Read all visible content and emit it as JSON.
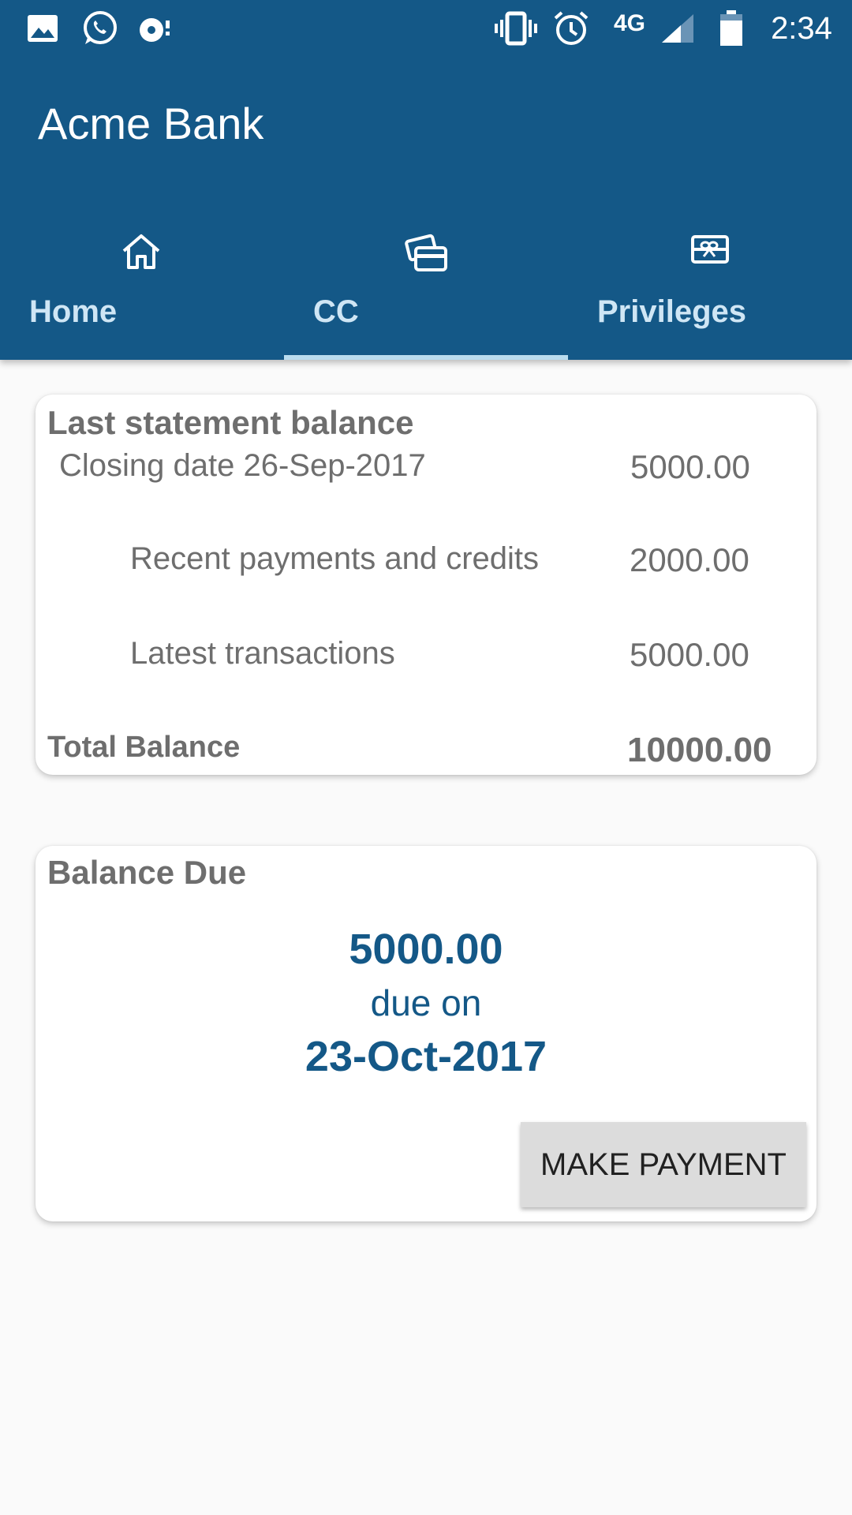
{
  "status_bar": {
    "network": "4G",
    "time": "2:34",
    "left_icons": [
      "image-icon",
      "whatsapp-icon",
      "sync-icon"
    ],
    "right_icons": [
      "vibrate-icon",
      "alarm-icon",
      "signal-icon",
      "battery-icon"
    ]
  },
  "app": {
    "title": "Acme Bank",
    "primary_color": "#145887"
  },
  "tabs": [
    {
      "label": "Home",
      "icon": "home-icon",
      "selected": false
    },
    {
      "label": "CC",
      "icon": "credit-card-icon",
      "selected": true
    },
    {
      "label": "Privileges",
      "icon": "gift-card-icon",
      "selected": false
    }
  ],
  "statement": {
    "title": "Last statement balance",
    "closing_label": "Closing date 26-Sep-2017",
    "closing_value": "5000.00",
    "payments_label": "Recent payments and credits",
    "payments_value": "2000.00",
    "transactions_label": "Latest transactions",
    "transactions_value": "5000.00",
    "total_label": "Total Balance",
    "total_value": "10000.00"
  },
  "balance_due": {
    "title": "Balance Due",
    "amount": "5000.00",
    "due_on_label": "due on",
    "due_date": "23-Oct-2017",
    "button_label": "MAKE PAYMENT"
  }
}
